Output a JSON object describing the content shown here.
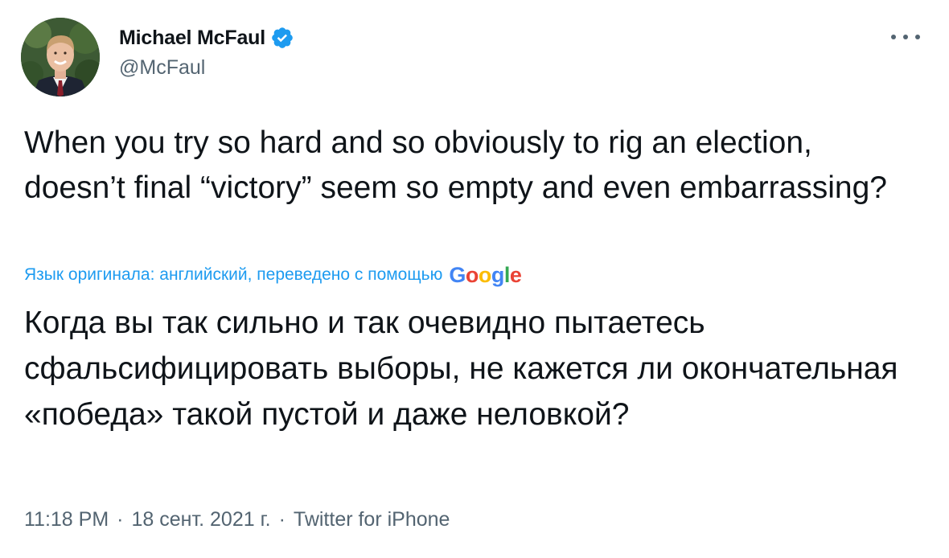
{
  "author": {
    "display_name": "Michael McFaul",
    "handle": "@McFaul",
    "verified": true,
    "avatar_icon": "profile-photo"
  },
  "tweet": {
    "text": "When you try so hard and so obviously to rig an election, doesn’t final “victory” seem so empty and even embarrassing?",
    "translation_note": "Язык оригинала: английский, переведено с помощью",
    "translation_provider": "Google",
    "translated_text": "Когда вы так сильно и так очевидно пытаетесь сфальсифицировать выборы, не кажется ли окончательная «победа» такой пустой и даже неловкой?"
  },
  "meta": {
    "time": "11:18 PM",
    "separator": "·",
    "date": "18 сент. 2021 г.",
    "source": "Twitter for iPhone"
  },
  "colors": {
    "text": "#0f1419",
    "secondary": "#536471",
    "link": "#1d9bf0",
    "verified": "#1d9bf0"
  },
  "icons": {
    "verified": "verified-badge-icon",
    "more": "more-options-icon"
  }
}
